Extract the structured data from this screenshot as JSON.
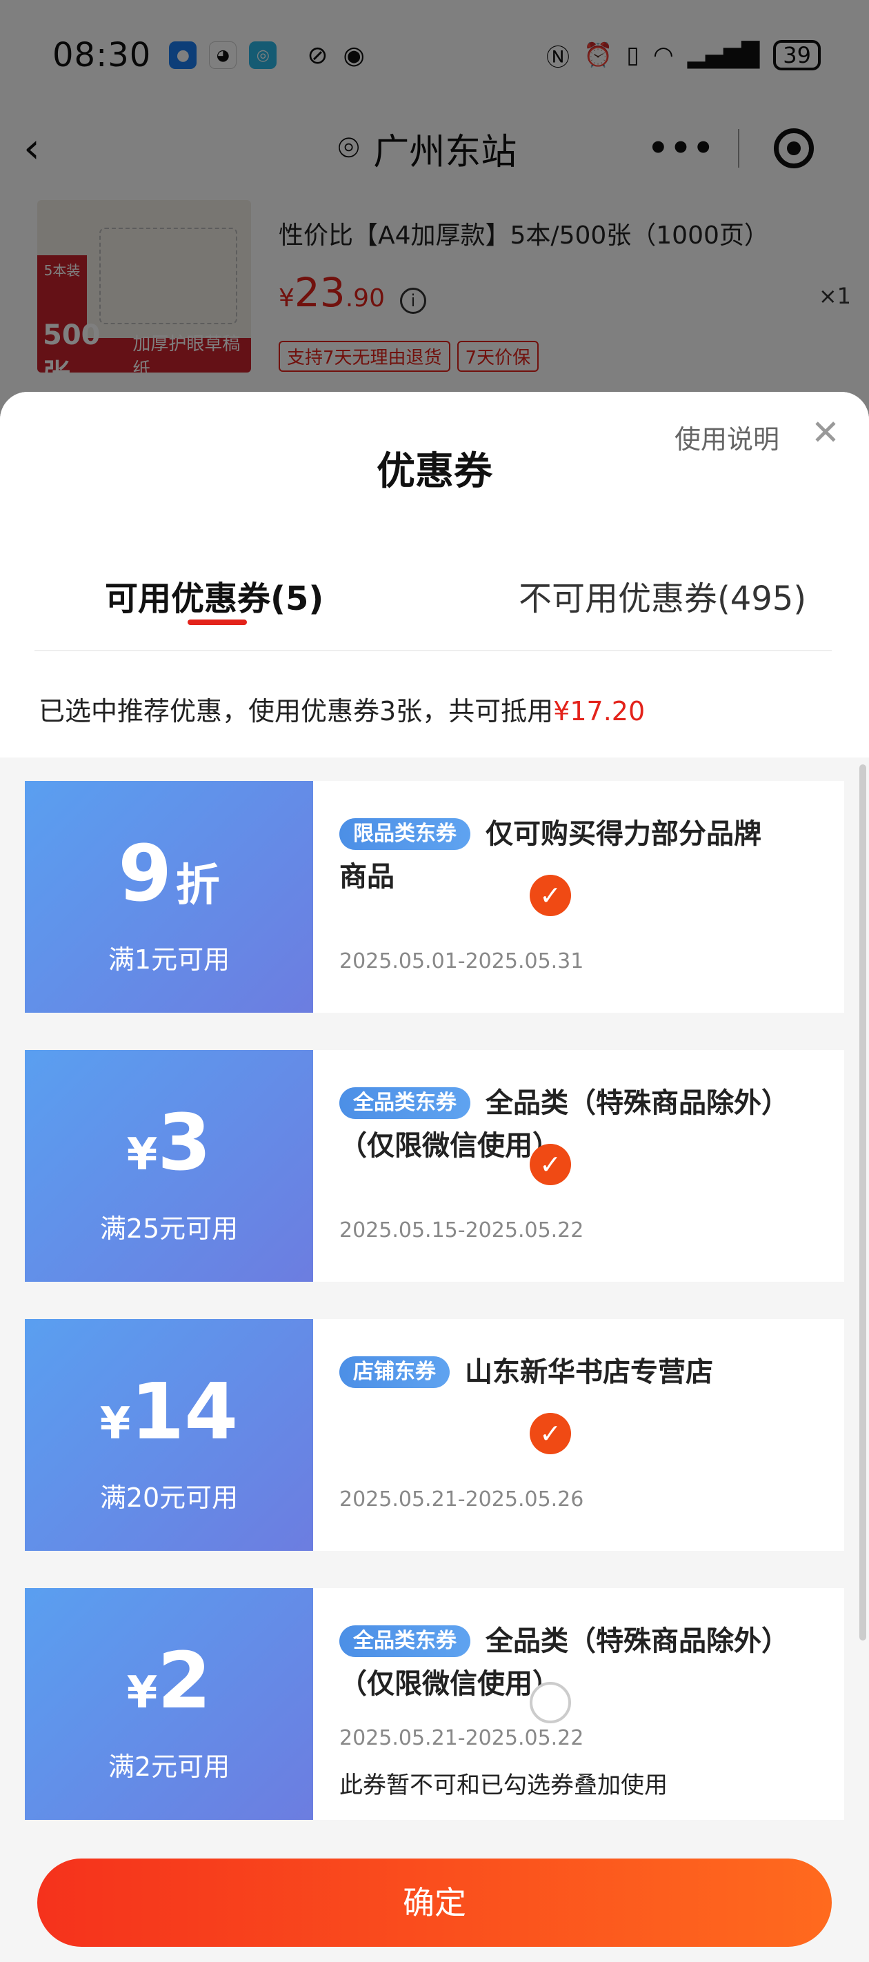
{
  "status_bar": {
    "time": "08:30",
    "battery": "39",
    "icons": [
      "chat-app-icon",
      "qq-icon",
      "browser-app-icon",
      "nfc-icon",
      "alarm-icon",
      "vibrate-icon",
      "wifi-icon",
      "signal-icon",
      "battery-icon"
    ]
  },
  "nav": {
    "location": "广州东站",
    "more_label": "•••"
  },
  "product": {
    "title": "性价比【A4加厚款】5本/500张（1000页）",
    "price_currency": "¥",
    "price_int": "23",
    "price_dec": ".90",
    "quantity": "×1",
    "img_tag_top": "5本装",
    "img_count": "500张",
    "img_caption": "加厚护眼草稿纸",
    "tags": [
      "支持7天无理由退货",
      "7天价保"
    ]
  },
  "sheet": {
    "title": "优惠券",
    "help": "使用说明",
    "tabs": {
      "available": "可用优惠券(5)",
      "unavailable": "不可用优惠券(495)"
    },
    "summary_text": "已选中推荐优惠，使用优惠券3张，共可抵用",
    "summary_amount": "¥17.20"
  },
  "coupons": [
    {
      "value_big": "9",
      "value_small": "折",
      "condition": "满1元可用",
      "badge": "限品类东券",
      "desc": "仅可购买得力部分品牌商品",
      "date": "2025.05.01-2025.05.31",
      "selected": true
    },
    {
      "value_small": "¥",
      "value_big": "3",
      "condition": "满25元可用",
      "badge": "全品类东券",
      "desc": "全品类（特殊商品除外）（仅限微信使用）",
      "date": "2025.05.15-2025.05.22",
      "selected": true
    },
    {
      "value_small": "¥",
      "value_big": "14",
      "condition": "满20元可用",
      "badge": "店铺东券",
      "desc": "山东新华书店专营店",
      "date": "2025.05.21-2025.05.26",
      "selected": true
    },
    {
      "value_small": "¥",
      "value_big": "2",
      "condition": "满2元可用",
      "badge": "全品类东券",
      "desc": "全品类（特殊商品除外）（仅限微信使用）",
      "date": "2025.05.21-2025.05.22",
      "note": "此券暂不可和已勾选券叠加使用",
      "selected": false
    }
  ],
  "confirm_label": "确定",
  "colors": {
    "accent_red": "#e3231b",
    "check_orange": "#f04a14",
    "coupon_blue": "#5a9ff0"
  }
}
